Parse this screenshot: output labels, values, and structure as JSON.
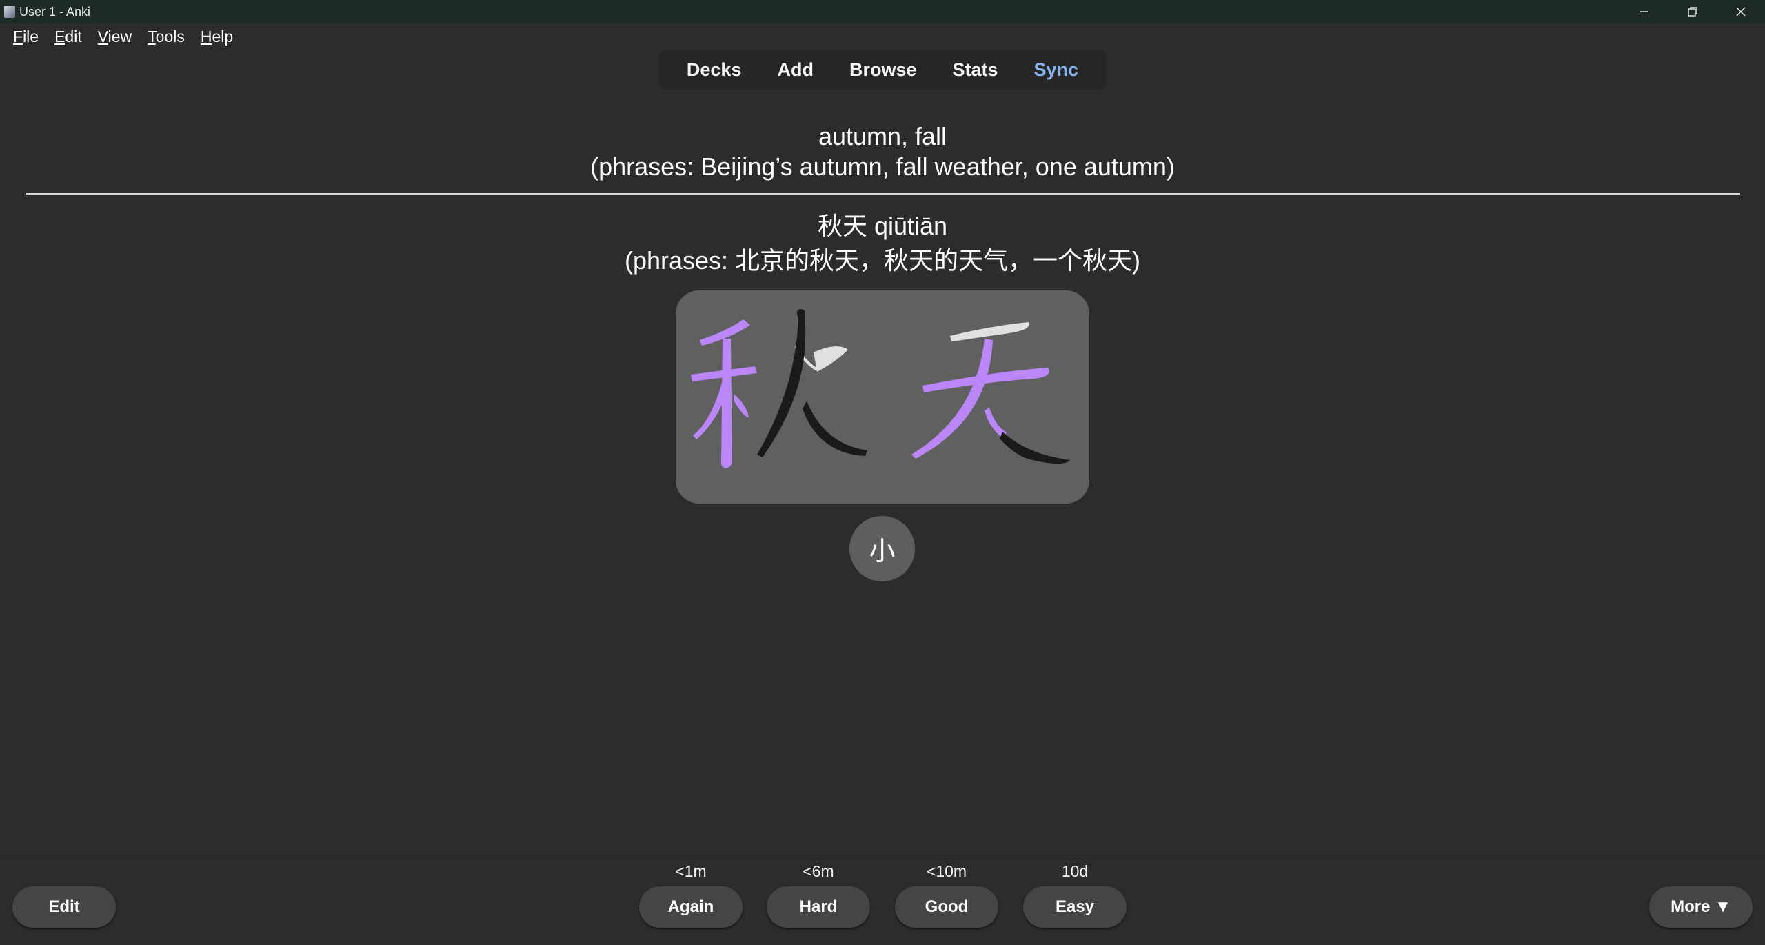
{
  "window": {
    "title": "User 1 - Anki",
    "controls": [
      "minimize-icon",
      "restore-icon",
      "close-icon"
    ]
  },
  "menu": {
    "items": [
      {
        "first": "F",
        "rest": "ile"
      },
      {
        "first": "E",
        "rest": "dit"
      },
      {
        "first": "V",
        "rest": "iew"
      },
      {
        "first": "T",
        "rest": "ools"
      },
      {
        "first": "H",
        "rest": "elp"
      }
    ]
  },
  "toolbar": {
    "decks": "Decks",
    "add": "Add",
    "browse": "Browse",
    "stats": "Stats",
    "sync": "Sync",
    "sync_color": "#86b3ef"
  },
  "card": {
    "front_line1": "autumn, fall",
    "front_line2": "(phrases: Beijing’s autumn, fall weather, one autumn)",
    "back_line1": "秋天 qiūtiān",
    "back_line2": "(phrases: 北京的秋天，秋天的天气，一个秋天)",
    "stroke_colors": {
      "highlight": "#bb86f7",
      "done": "#1a1a1a",
      "pending": "#e0e0e0",
      "box_bg": "#606060"
    },
    "audio_label": "小"
  },
  "answer_buttons": {
    "edit": "Edit",
    "again": {
      "label": "Again",
      "interval": "<1m"
    },
    "hard": {
      "label": "Hard",
      "interval": "<6m"
    },
    "good": {
      "label": "Good",
      "interval": "<10m"
    },
    "easy": {
      "label": "Easy",
      "interval": "10d"
    },
    "more": "More ▼"
  }
}
